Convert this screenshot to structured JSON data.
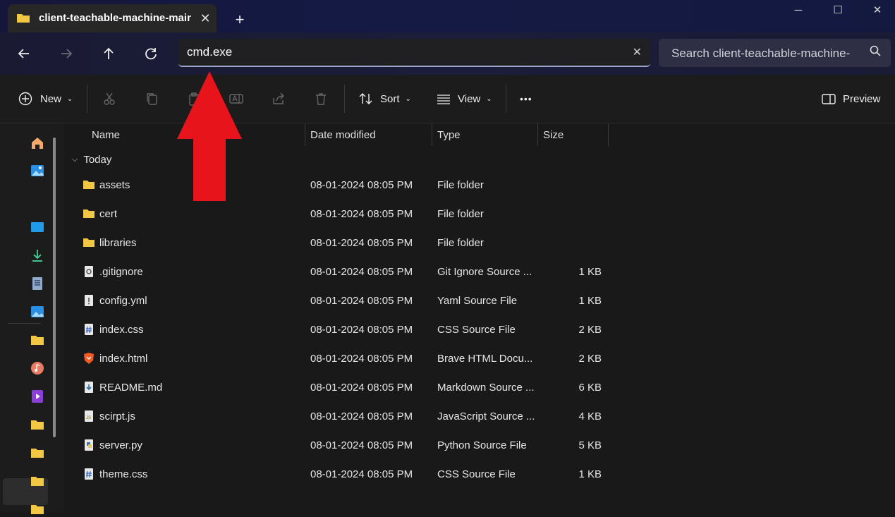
{
  "window": {
    "tab_title": "client-teachable-machine-main",
    "minimize": "─",
    "maximize": "☐",
    "close": "✕"
  },
  "address_bar": {
    "value": "cmd.exe",
    "search_placeholder": "Search client-teachable-machine-"
  },
  "toolbar": {
    "new_label": "New",
    "sort_label": "Sort",
    "view_label": "View",
    "more_label": "•••",
    "preview_label": "Preview"
  },
  "columns": {
    "name": "Name",
    "date": "Date modified",
    "type": "Type",
    "size": "Size"
  },
  "group": {
    "label": "Today"
  },
  "files": [
    {
      "name": "assets",
      "date": "08-01-2024 08:05 PM",
      "type": "File folder",
      "size": "",
      "icon": "folder-icon"
    },
    {
      "name": "cert",
      "date": "08-01-2024 08:05 PM",
      "type": "File folder",
      "size": "",
      "icon": "folder-icon"
    },
    {
      "name": "libraries",
      "date": "08-01-2024 08:05 PM",
      "type": "File folder",
      "size": "",
      "icon": "folder-icon"
    },
    {
      "name": ".gitignore",
      "date": "08-01-2024 08:05 PM",
      "type": "Git Ignore Source ...",
      "size": "1 KB",
      "icon": "gear-file-icon"
    },
    {
      "name": "config.yml",
      "date": "08-01-2024 08:05 PM",
      "type": "Yaml Source File",
      "size": "1 KB",
      "icon": "yaml-file-icon"
    },
    {
      "name": "index.css",
      "date": "08-01-2024 08:05 PM",
      "type": "CSS Source File",
      "size": "2 KB",
      "icon": "css-file-icon"
    },
    {
      "name": "index.html",
      "date": "08-01-2024 08:05 PM",
      "type": "Brave HTML Docu...",
      "size": "2 KB",
      "icon": "brave-icon"
    },
    {
      "name": "README.md",
      "date": "08-01-2024 08:05 PM",
      "type": "Markdown Source ...",
      "size": "6 KB",
      "icon": "markdown-file-icon"
    },
    {
      "name": "scirpt.js",
      "date": "08-01-2024 08:05 PM",
      "type": "JavaScript Source ...",
      "size": "4 KB",
      "icon": "js-file-icon"
    },
    {
      "name": "server.py",
      "date": "08-01-2024 08:05 PM",
      "type": "Python Source File",
      "size": "5 KB",
      "icon": "python-file-icon"
    },
    {
      "name": "theme.css",
      "date": "08-01-2024 08:05 PM",
      "type": "CSS Source File",
      "size": "1 KB",
      "icon": "css-file-icon"
    }
  ],
  "colors": {
    "accent_arrow": "#e8141c",
    "folder": "#f2c744"
  }
}
